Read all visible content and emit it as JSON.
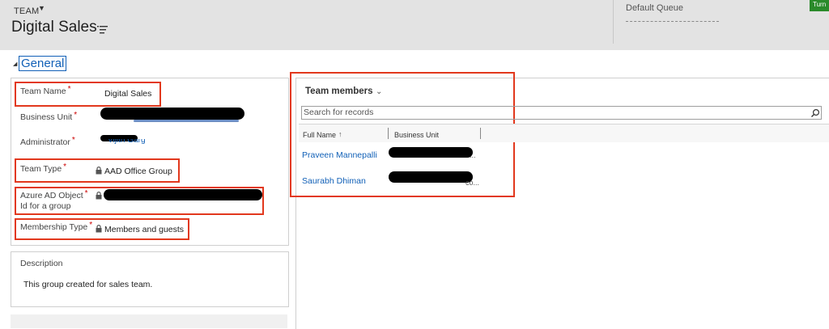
{
  "header": {
    "entity_type": "TEAM",
    "record_title": "Digital Sales",
    "queue_label": "Default Queue",
    "turn_button_label": "Turn"
  },
  "section": {
    "label": "General"
  },
  "fields": {
    "team_name": {
      "label": "Team Name",
      "value": "Digital Sales",
      "required": "*"
    },
    "business_unit": {
      "label": "Business Unit",
      "required": "*"
    },
    "administrator": {
      "label": "Administrator",
      "required": "*",
      "value_partial": "Vijith Garg"
    },
    "team_type": {
      "label": "Team Type",
      "required": "*",
      "value": "AAD Office Group"
    },
    "azure_ad_object_id": {
      "label_line1": "Azure AD Object",
      "label_line2": "Id for a group",
      "required": "*"
    },
    "membership_type": {
      "label": "Membership Type",
      "required": "*",
      "value": "Members and guests"
    }
  },
  "description": {
    "label": "Description",
    "value": "This group created for sales team."
  },
  "subgrid": {
    "title": "Team members",
    "search_placeholder": "Search for records",
    "columns": [
      "Full Name",
      "Business Unit"
    ],
    "sort_indicator": "↑",
    "rows": [
      {
        "full_name": "Praveen Mannepalli",
        "business_unit_suffix": "..."
      },
      {
        "full_name": "Saurabh Dhiman",
        "business_unit_suffix": "co..."
      }
    ]
  },
  "colors": {
    "accent_link": "#1160b7",
    "highlight_box": "#e2381d",
    "required_star": "#cc0000",
    "turn_button": "#2a8a2a",
    "header_band": "#e3e3e3"
  },
  "icons": {
    "title_menu": "list-menu-icon",
    "lock": "lock-icon",
    "search": "search-icon",
    "section_toggle": "triangle-collapse-icon",
    "entity_dropdown": "caret-down-icon",
    "grid_dropdown": "chevron-down-icon"
  }
}
